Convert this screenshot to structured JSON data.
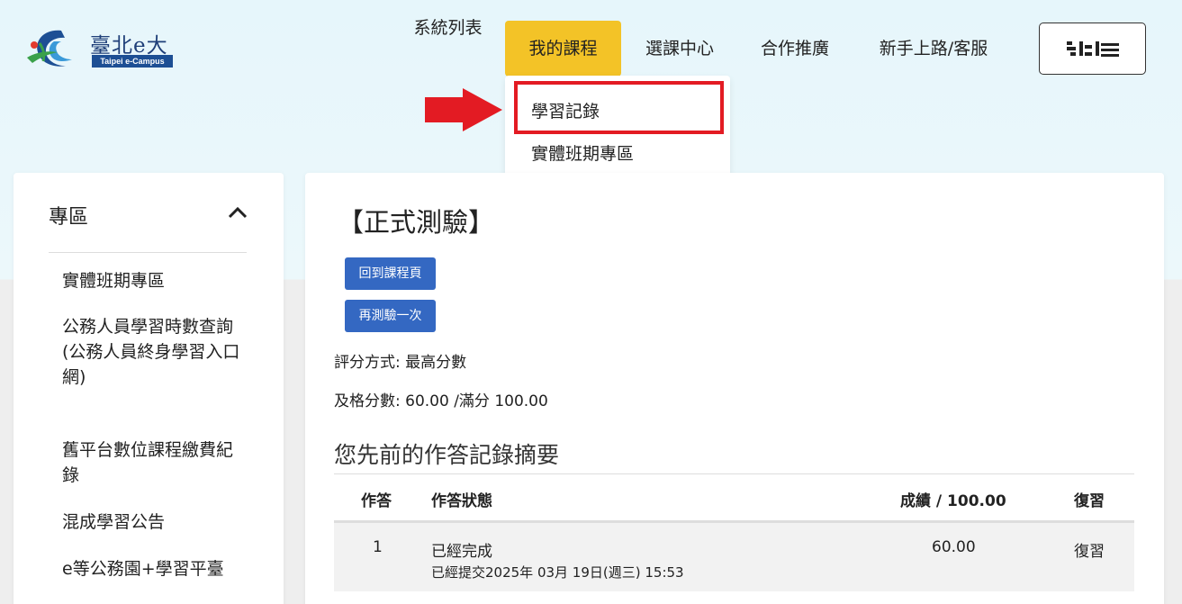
{
  "header": {
    "logo_cn": "臺北e大",
    "logo_en": "Taipei e-Campus",
    "nav": [
      {
        "label": "系統列表"
      },
      {
        "label": "我的課程"
      },
      {
        "label": "選課中心"
      },
      {
        "label": "合作推廣"
      },
      {
        "label": "新手上路/客服"
      }
    ],
    "menu_button_label": "..."
  },
  "dropdown": {
    "items": [
      {
        "label": "學習記錄"
      },
      {
        "label": "實體班期專區"
      }
    ]
  },
  "sidebar": {
    "title": "專區",
    "items": [
      {
        "label": "實體班期專區"
      },
      {
        "label": "公務人員學習時數查詢(公務人員終身學習入口網)"
      },
      {
        "label": "舊平台數位課程繳費紀錄"
      },
      {
        "label": "混成學習公告"
      },
      {
        "label": "e等公務園+學習平臺"
      }
    ]
  },
  "main": {
    "title": "【正式測驗】",
    "back_button": "回到課程頁",
    "retry_button": "再測驗一次",
    "grading_method": "評分方式: 最高分數",
    "passing_score": "及格分數:  60.00 /滿分 100.00",
    "summary_title": "您先前的作答記錄摘要",
    "table": {
      "headers": [
        "作答",
        "作答狀態",
        "成績 / 100.00",
        "復習"
      ],
      "rows": [
        {
          "attempt": "1",
          "status": "已經完成",
          "submitted": "已經提交2025年 03月 19日(週三) 15:53",
          "score": "60.00",
          "review": "復習"
        }
      ]
    }
  },
  "colors": {
    "nav_active": "#f3c327",
    "button": "#3468c2",
    "highlight": "#e31b23"
  }
}
